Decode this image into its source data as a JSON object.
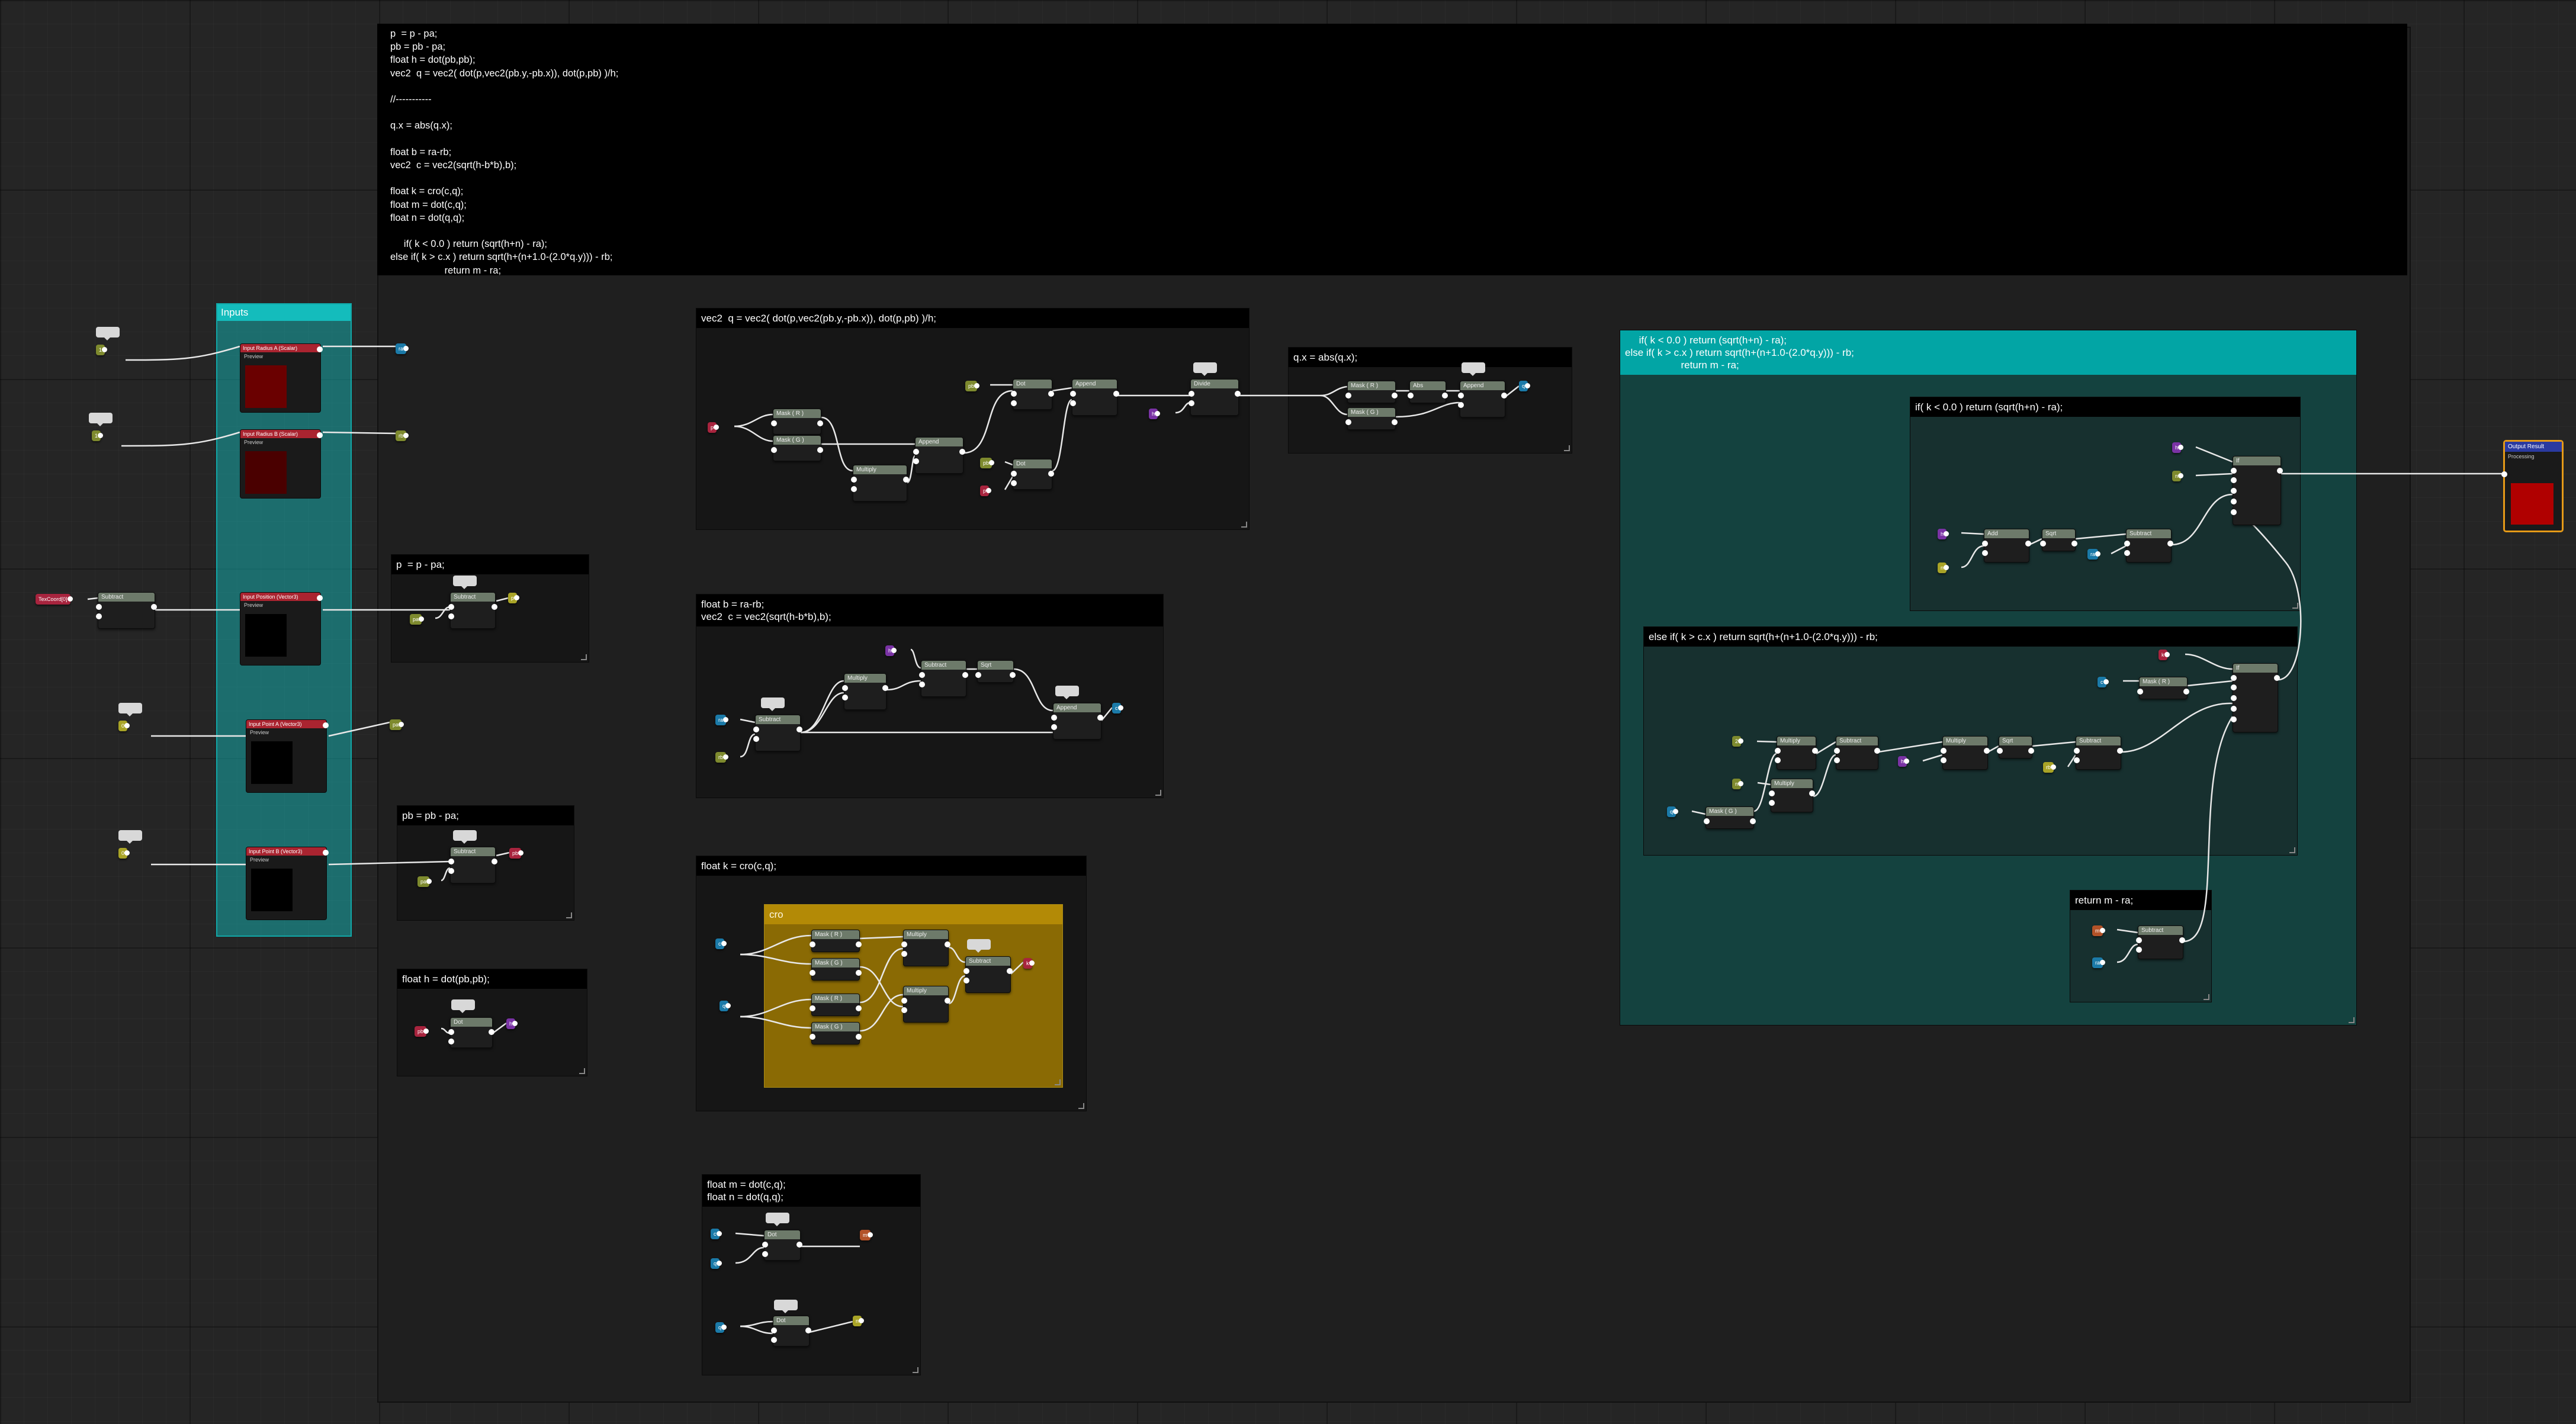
{
  "code": {
    "lines": [
      "p  = p - pa;",
      "pb = pb - pa;",
      "float h = dot(pb,pb);",
      "vec2  q = vec2( dot(p,vec2(pb.y,-pb.x)), dot(p,pb) )/h;",
      "",
      "//-----------",
      "",
      "q.x = abs(q.x);",
      "",
      "float b = ra-rb;",
      "vec2  c = vec2(sqrt(h-b*b),b);",
      "",
      "float k = cro(c,q);",
      "float m = dot(c,q);",
      "float n = dot(q,q);",
      "",
      "     if( k < 0.0 ) return (sqrt(h+n) - ra);",
      "else if( k > c.x ) return sqrt(h+(n+1.0-(2.0*q.y))) - rb;",
      "                    return m - ra;"
    ]
  },
  "groups": {
    "inputs": "Inputs",
    "p": "p  = p - pa;",
    "pb": "pb = pb - pa;",
    "h": "float h = dot(pb,pb);",
    "q": "vec2  q = vec2( dot(p,vec2(pb.y,-pb.x)), dot(p,pb) )/h;",
    "qx": "q.x = abs(q.x);",
    "bc": "float b = ra-rb;\nvec2  c = vec2(sqrt(h-b*b),b);",
    "k": "float k = cro(c,q);",
    "cro": "cro",
    "mn": "float m = dot(c,q);\nfloat n = dot(q,q);",
    "returns": "     if( k < 0.0 ) return (sqrt(h+n) - ra);\nelse if( k > c.x ) return sqrt(h+(n+1.0-(2.0*q.y))) - rb;\n                    return m - ra;",
    "if1": "if( k < 0.0 ) return (sqrt(h+n) - ra);",
    "if2": "else if( k > c.x ) return sqrt(h+(n+1.0-(2.0*q.y))) - rb;",
    "ret": "return m - ra;"
  },
  "inputs": [
    {
      "label": "Input Radius A (Scalar)",
      "preview": "Preview"
    },
    {
      "label": "Input Radius B (Scalar)",
      "preview": "Preview"
    },
    {
      "label": "Input Position (Vector3)",
      "preview": "Preview"
    },
    {
      "label": "Input Point A (Vector3)",
      "preview": "Preview"
    },
    {
      "label": "Input Point B (Vector3)",
      "preview": "Preview"
    }
  ],
  "nodes": {
    "texcoord": "TexCoord[0]",
    "subtract": "Subtract",
    "multiply": "Multiply",
    "dot": "Dot",
    "append": "Append",
    "divide": "Divide",
    "abs": "Abs",
    "sqrt": "Sqrt",
    "mask_r": "Mask ( R )",
    "mask_g": "Mask ( G )",
    "if": "If",
    "add": "Add",
    "one_minus": "1-x",
    "const_neg1": "-1",
    "const_2": "2",
    "const_0": "0",
    "const_1": "1"
  },
  "named_reroutes": [
    "ra",
    "rb",
    "p",
    "pa",
    "pb",
    "h",
    "q",
    "b",
    "c",
    "k",
    "m",
    "n"
  ],
  "pin_labels": {
    "a": "A",
    "b": "B",
    "agtb": "A > B",
    "aeqb": "A == B",
    "altb": "A < B"
  },
  "output": {
    "title": "Output Result",
    "subtitle": "Processing"
  },
  "colors": {
    "teal": "#14bcbc",
    "gold": "#b38a06",
    "input_header": "#aa2430",
    "output_border": "#e59a18"
  }
}
